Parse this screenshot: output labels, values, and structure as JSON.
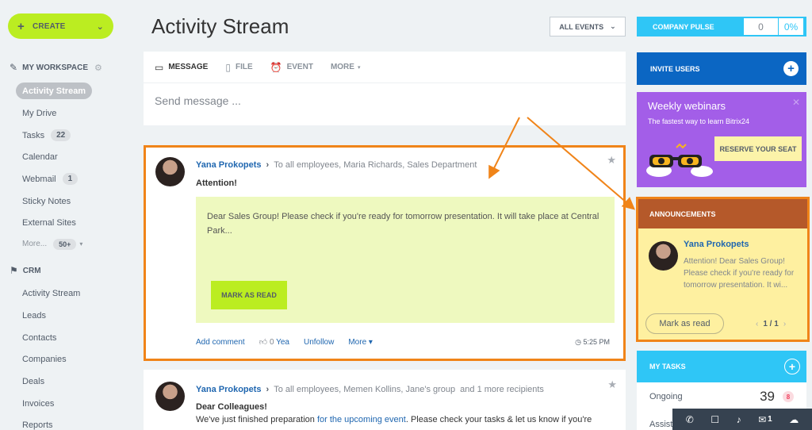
{
  "sidebar": {
    "create_label": "CREATE",
    "workspace_title": "MY WORKSPACE",
    "workspace_items": [
      {
        "label": "Activity Stream",
        "active": true
      },
      {
        "label": "My Drive"
      },
      {
        "label": "Tasks",
        "count": "22"
      },
      {
        "label": "Calendar"
      },
      {
        "label": "Webmail",
        "count": "1"
      },
      {
        "label": "Sticky Notes"
      },
      {
        "label": "External Sites"
      }
    ],
    "more_label": "More...",
    "more_count": "50+",
    "crm_title": "CRM",
    "crm_items": [
      {
        "label": "Activity Stream"
      },
      {
        "label": "Leads"
      },
      {
        "label": "Contacts"
      },
      {
        "label": "Companies"
      },
      {
        "label": "Deals"
      },
      {
        "label": "Invoices"
      },
      {
        "label": "Reports"
      }
    ]
  },
  "header": {
    "title": "Activity Stream",
    "filter_label": "ALL EVENTS"
  },
  "post_form": {
    "tabs": [
      {
        "label": "MESSAGE",
        "icon": "message-icon"
      },
      {
        "label": "FILE",
        "icon": "file-icon"
      },
      {
        "label": "EVENT",
        "icon": "event-icon"
      },
      {
        "label": "MORE",
        "icon": "chevron-down-icon"
      }
    ],
    "placeholder": "Send message ..."
  },
  "posts": [
    {
      "author": "Yana Prokopets",
      "recipients": "To all employees, Maria Richards, Sales Department",
      "title": "Attention!",
      "body": "Dear Sales Group! Please check if you're ready for tomorrow presentation. It will take place at Central Park...",
      "mark_label": "MARK AS READ",
      "actions": {
        "comment": "Add comment",
        "likes": "0",
        "like_label": "Yea",
        "unfollow": "Unfollow",
        "more": "More"
      },
      "time": "5:25 PM"
    },
    {
      "author": "Yana Prokopets",
      "recipients": "To all employees, Memen Kollins, Jane's group",
      "extra_recipients": "and 1 more recipients",
      "title": "Dear Colleagues!",
      "body_pre": "We've just finished preparation ",
      "body_link": "for the upcoming event",
      "body_post": ". Please check your tasks & let us know if you're"
    }
  ],
  "right": {
    "pulse": {
      "label": "COMPANY PULSE",
      "value": "0",
      "percent": "0%"
    },
    "invite_label": "INVITE USERS",
    "webinar": {
      "title": "Weekly webinars",
      "subtitle": "The fastest way to learn Bitrix24",
      "button": "RESERVE YOUR SEAT"
    },
    "announcements": {
      "title": "ANNOUNCEMENTS",
      "author": "Yana Prokopets",
      "text": "Attention! Dear Sales Group! Please check if you're ready for tomorrow presentation. It wi...",
      "mark_label": "Mark as read",
      "pager": "1 / 1"
    },
    "tasks": {
      "title": "MY TASKS",
      "rows": [
        {
          "label": "Ongoing",
          "count": "39",
          "badge": "8"
        },
        {
          "label": "Assist..."
        }
      ]
    }
  },
  "bottom_bar": {
    "items": [
      {
        "icon": "phone-icon"
      },
      {
        "icon": "chat-icon"
      },
      {
        "icon": "bell-icon"
      },
      {
        "icon": "mail-icon",
        "count": "1"
      },
      {
        "icon": "cloud-icon"
      }
    ]
  },
  "colors": {
    "accent_green": "#bbed21",
    "highlight_orange": "#f08419",
    "pulse_blue": "#2fc6f6",
    "invite_blue": "#0b66c3",
    "webinar_purple": "#a35ee8",
    "ann_header": "#b5592a",
    "ann_bg": "#fef0a0"
  }
}
